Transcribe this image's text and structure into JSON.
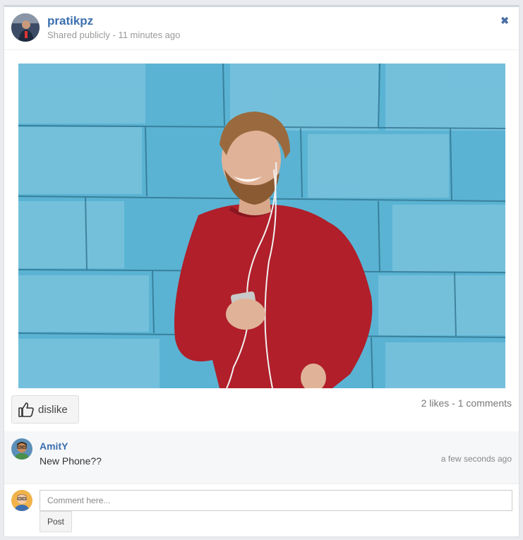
{
  "post": {
    "author": "pratikpz",
    "meta": "Shared publicly - 11 minutes ago",
    "close_icon": "close-icon",
    "stats": "2 likes - 1 comments"
  },
  "actions": {
    "like_label": "dislike",
    "like_icon": "thumbs-up-icon"
  },
  "comments": [
    {
      "user": "AmitY",
      "text": "New Phone??",
      "time": "a few seconds ago"
    }
  ],
  "composer": {
    "placeholder": "Comment here...",
    "post_label": "Post"
  },
  "colors": {
    "link": "#3c6fae",
    "wall": "#5ab3d3",
    "sweater": "#b01f2a"
  }
}
